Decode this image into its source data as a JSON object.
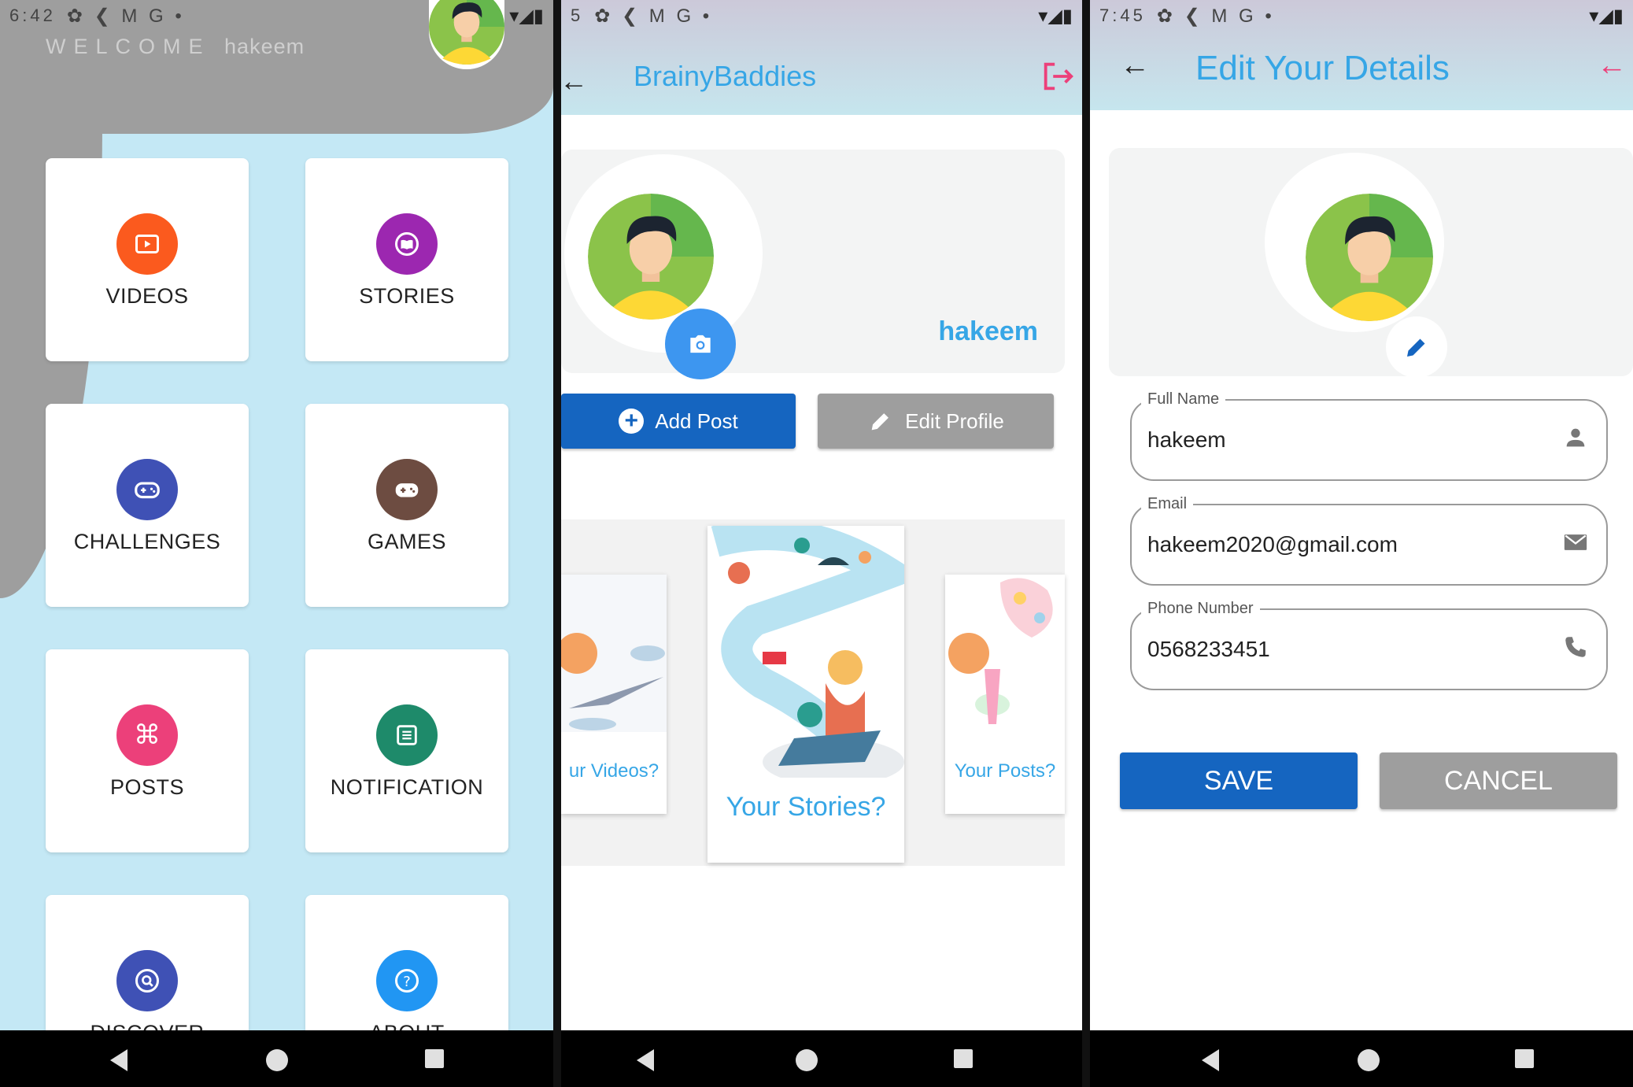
{
  "colors": {
    "accent_blue": "#36a6e6",
    "button_blue": "#1565c0",
    "button_grey": "#9e9e9e",
    "home_bg": "#c4e8f5",
    "logout_pink": "#ec407a"
  },
  "home": {
    "status_time": "6:42",
    "status_icons": "✿ ❮ M G •",
    "welcome_prefix": "WELCOME",
    "welcome_name": "hakeem",
    "tiles": [
      {
        "label": "VIDEOS",
        "icon": "play-icon",
        "color": "#fb5a1e"
      },
      {
        "label": "STORIES",
        "icon": "book-icon",
        "color": "#9c27b0"
      },
      {
        "label": "CHALLENGES",
        "icon": "gamepad-icon",
        "color": "#3f51b5"
      },
      {
        "label": "GAMES",
        "icon": "controller-icon",
        "color": "#6d4c41"
      },
      {
        "label": "POSTS",
        "icon": "command-icon",
        "color": "#ec407a"
      },
      {
        "label": "NOTIFICATION",
        "icon": "list-icon",
        "color": "#1e8a6a"
      },
      {
        "label": "DISCOVER",
        "icon": "search-icon",
        "color": "#3f51b5"
      },
      {
        "label": "ABOUT",
        "icon": "help-icon",
        "color": "#2196f3"
      }
    ]
  },
  "profile": {
    "status_time": "5",
    "status_icons": "✿ ❮ M G •",
    "app_title": "BrainyBaddies",
    "username": "hakeem",
    "add_post_label": "Add Post",
    "edit_profile_label": "Edit Profile",
    "cards": [
      "ur Videos?",
      "Your Stories?",
      "Your Posts?"
    ]
  },
  "edit": {
    "status_time": "7:45",
    "status_icons": "✿ ❮ M G •",
    "title": "Edit Your Details",
    "fields": [
      {
        "label": "Full Name",
        "value": "hakeem",
        "icon": "person-icon"
      },
      {
        "label": "Email",
        "value": "hakeem2020@gmail.com",
        "icon": "mail-icon"
      },
      {
        "label": "Phone Number",
        "value": "0568233451",
        "icon": "phone-icon"
      }
    ],
    "save_label": "SAVE",
    "cancel_label": "CANCEL"
  }
}
